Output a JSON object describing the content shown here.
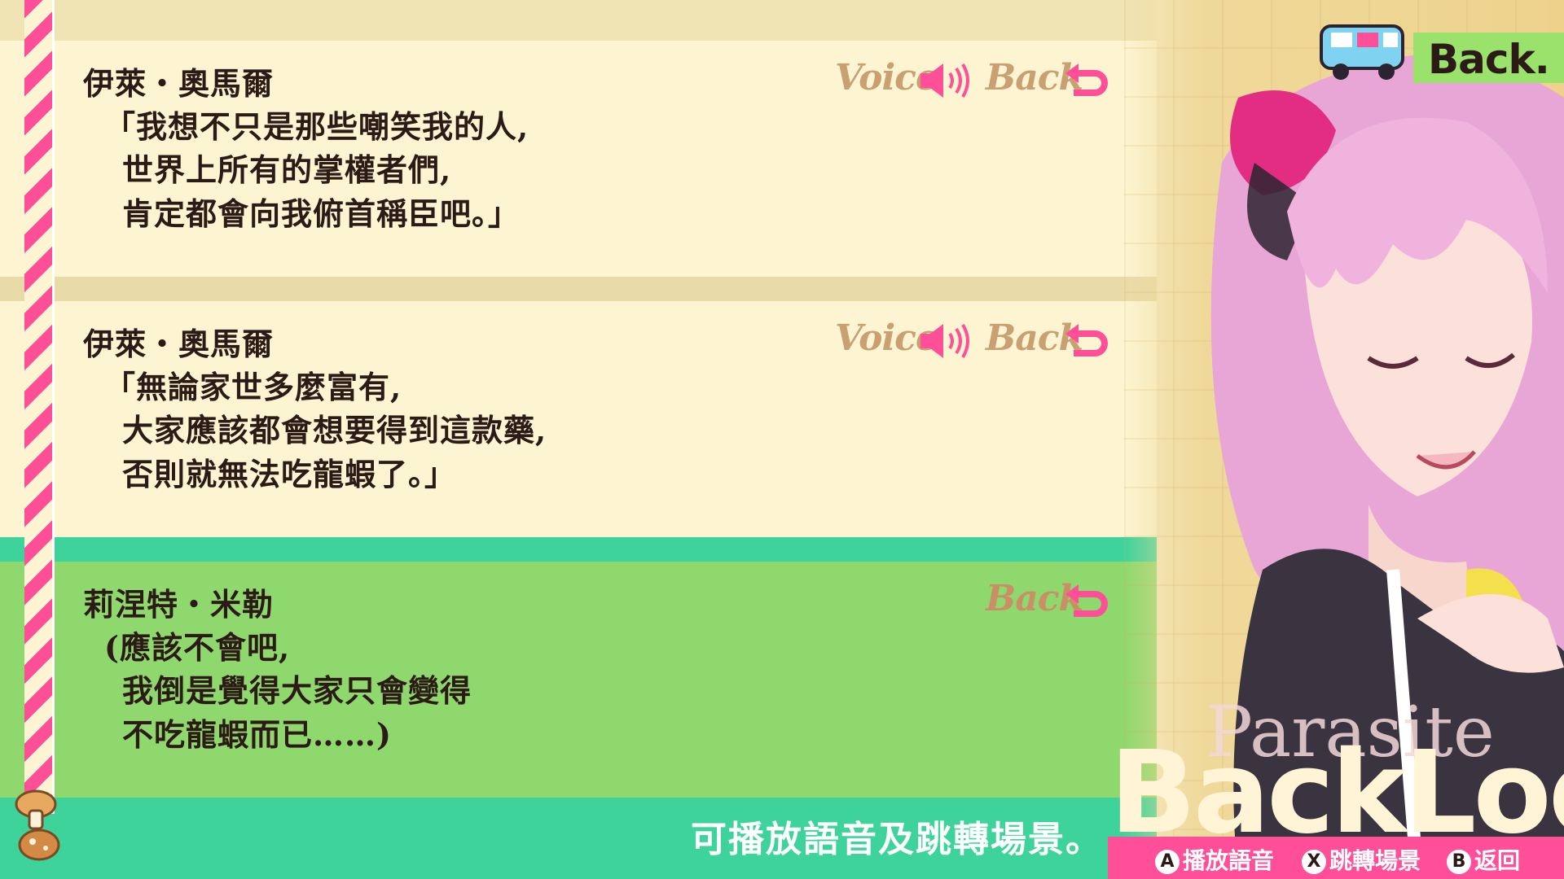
{
  "header": {
    "back_label": "Back."
  },
  "entries": [
    {
      "speaker": "伊萊・奧馬爾",
      "lines": [
        "「我想不只是那些嘲笑我的人,",
        "世界上所有的掌權者們,",
        "肯定都會向我俯首稱臣吧。」"
      ],
      "voice_label": "Voice",
      "back_label": "Back"
    },
    {
      "speaker": "伊萊・奧馬爾",
      "lines": [
        "「無論家世多麼富有,",
        "大家應該都會想要得到這款藥,",
        "否則就無法吃龍蝦了。」"
      ],
      "voice_label": "Voice",
      "back_label": "Back"
    },
    {
      "speaker": "莉涅特・米勒",
      "lines": [
        "(應該不會吧,",
        "我倒是覺得大家只會變得",
        "不吃龍蝦而已……)"
      ],
      "back_label": "Back"
    }
  ],
  "footer": {
    "hint_text": "可播放語音及跳轉場景。"
  },
  "logo": {
    "sub": "Parasite",
    "main": "BackLog"
  },
  "controls": [
    {
      "key": "A",
      "label": "播放語音"
    },
    {
      "key": "X",
      "label": "跳轉場景"
    },
    {
      "key": "B",
      "label": "返回"
    }
  ],
  "colors": {
    "accent_pink": "#ff4f98",
    "cream": "#fdf5d2",
    "green": "#8fd86d",
    "teal": "#3ed39b",
    "gold": "#c9a072"
  }
}
